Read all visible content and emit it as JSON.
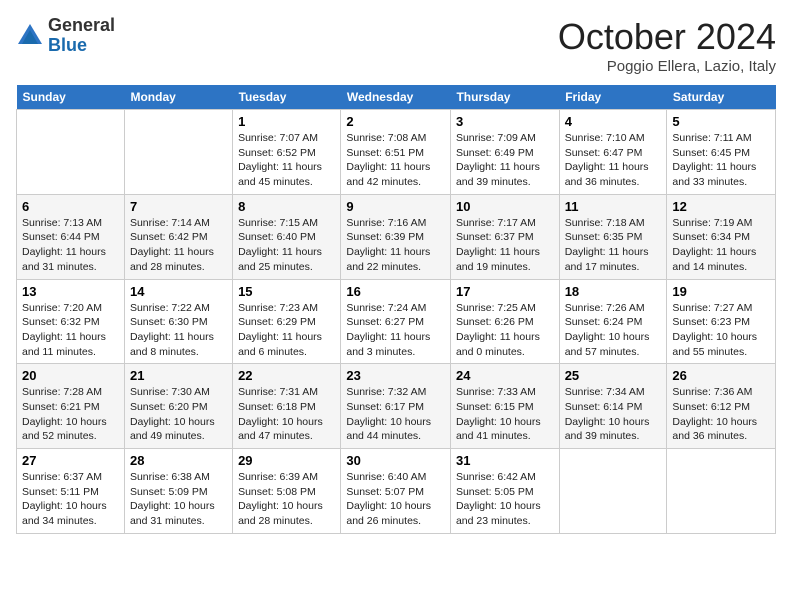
{
  "header": {
    "logo_general": "General",
    "logo_blue": "Blue",
    "month_title": "October 2024",
    "location": "Poggio Ellera, Lazio, Italy"
  },
  "days_of_week": [
    "Sunday",
    "Monday",
    "Tuesday",
    "Wednesday",
    "Thursday",
    "Friday",
    "Saturday"
  ],
  "weeks": [
    [
      null,
      null,
      {
        "day": 1,
        "sunrise": "7:07 AM",
        "sunset": "6:52 PM",
        "daylight": "11 hours and 45 minutes."
      },
      {
        "day": 2,
        "sunrise": "7:08 AM",
        "sunset": "6:51 PM",
        "daylight": "11 hours and 42 minutes."
      },
      {
        "day": 3,
        "sunrise": "7:09 AM",
        "sunset": "6:49 PM",
        "daylight": "11 hours and 39 minutes."
      },
      {
        "day": 4,
        "sunrise": "7:10 AM",
        "sunset": "6:47 PM",
        "daylight": "11 hours and 36 minutes."
      },
      {
        "day": 5,
        "sunrise": "7:11 AM",
        "sunset": "6:45 PM",
        "daylight": "11 hours and 33 minutes."
      }
    ],
    [
      {
        "day": 6,
        "sunrise": "7:13 AM",
        "sunset": "6:44 PM",
        "daylight": "11 hours and 31 minutes."
      },
      {
        "day": 7,
        "sunrise": "7:14 AM",
        "sunset": "6:42 PM",
        "daylight": "11 hours and 28 minutes."
      },
      {
        "day": 8,
        "sunrise": "7:15 AM",
        "sunset": "6:40 PM",
        "daylight": "11 hours and 25 minutes."
      },
      {
        "day": 9,
        "sunrise": "7:16 AM",
        "sunset": "6:39 PM",
        "daylight": "11 hours and 22 minutes."
      },
      {
        "day": 10,
        "sunrise": "7:17 AM",
        "sunset": "6:37 PM",
        "daylight": "11 hours and 19 minutes."
      },
      {
        "day": 11,
        "sunrise": "7:18 AM",
        "sunset": "6:35 PM",
        "daylight": "11 hours and 17 minutes."
      },
      {
        "day": 12,
        "sunrise": "7:19 AM",
        "sunset": "6:34 PM",
        "daylight": "11 hours and 14 minutes."
      }
    ],
    [
      {
        "day": 13,
        "sunrise": "7:20 AM",
        "sunset": "6:32 PM",
        "daylight": "11 hours and 11 minutes."
      },
      {
        "day": 14,
        "sunrise": "7:22 AM",
        "sunset": "6:30 PM",
        "daylight": "11 hours and 8 minutes."
      },
      {
        "day": 15,
        "sunrise": "7:23 AM",
        "sunset": "6:29 PM",
        "daylight": "11 hours and 6 minutes."
      },
      {
        "day": 16,
        "sunrise": "7:24 AM",
        "sunset": "6:27 PM",
        "daylight": "11 hours and 3 minutes."
      },
      {
        "day": 17,
        "sunrise": "7:25 AM",
        "sunset": "6:26 PM",
        "daylight": "11 hours and 0 minutes."
      },
      {
        "day": 18,
        "sunrise": "7:26 AM",
        "sunset": "6:24 PM",
        "daylight": "10 hours and 57 minutes."
      },
      {
        "day": 19,
        "sunrise": "7:27 AM",
        "sunset": "6:23 PM",
        "daylight": "10 hours and 55 minutes."
      }
    ],
    [
      {
        "day": 20,
        "sunrise": "7:28 AM",
        "sunset": "6:21 PM",
        "daylight": "10 hours and 52 minutes."
      },
      {
        "day": 21,
        "sunrise": "7:30 AM",
        "sunset": "6:20 PM",
        "daylight": "10 hours and 49 minutes."
      },
      {
        "day": 22,
        "sunrise": "7:31 AM",
        "sunset": "6:18 PM",
        "daylight": "10 hours and 47 minutes."
      },
      {
        "day": 23,
        "sunrise": "7:32 AM",
        "sunset": "6:17 PM",
        "daylight": "10 hours and 44 minutes."
      },
      {
        "day": 24,
        "sunrise": "7:33 AM",
        "sunset": "6:15 PM",
        "daylight": "10 hours and 41 minutes."
      },
      {
        "day": 25,
        "sunrise": "7:34 AM",
        "sunset": "6:14 PM",
        "daylight": "10 hours and 39 minutes."
      },
      {
        "day": 26,
        "sunrise": "7:36 AM",
        "sunset": "6:12 PM",
        "daylight": "10 hours and 36 minutes."
      }
    ],
    [
      {
        "day": 27,
        "sunrise": "6:37 AM",
        "sunset": "5:11 PM",
        "daylight": "10 hours and 34 minutes."
      },
      {
        "day": 28,
        "sunrise": "6:38 AM",
        "sunset": "5:09 PM",
        "daylight": "10 hours and 31 minutes."
      },
      {
        "day": 29,
        "sunrise": "6:39 AM",
        "sunset": "5:08 PM",
        "daylight": "10 hours and 28 minutes."
      },
      {
        "day": 30,
        "sunrise": "6:40 AM",
        "sunset": "5:07 PM",
        "daylight": "10 hours and 26 minutes."
      },
      {
        "day": 31,
        "sunrise": "6:42 AM",
        "sunset": "5:05 PM",
        "daylight": "10 hours and 23 minutes."
      },
      null,
      null
    ]
  ]
}
